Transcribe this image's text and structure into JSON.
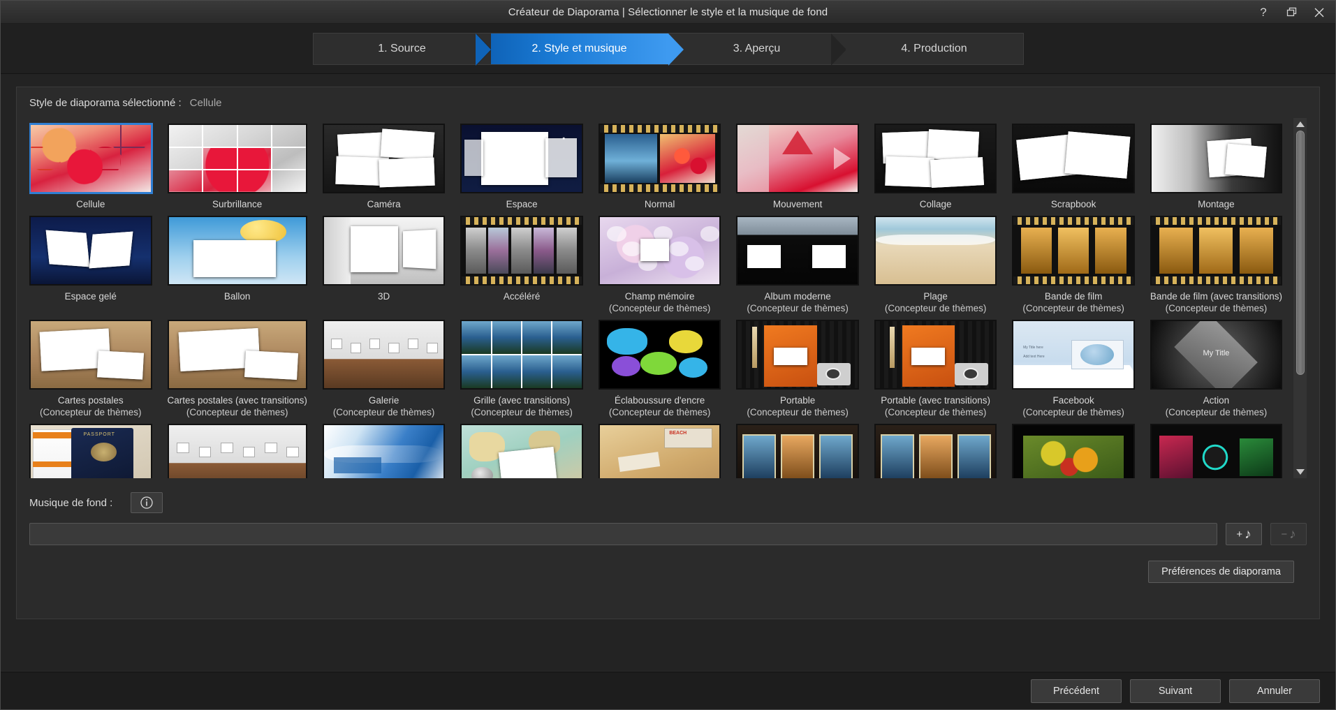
{
  "titlebar": {
    "title": "Créateur de Diaporama | Sélectionner le style et la musique de fond",
    "help_icon": "question-mark-icon",
    "restore_icon": "restore-window-icon",
    "close_icon": "close-icon"
  },
  "wizard": {
    "steps": [
      {
        "label": "1. Source",
        "active": false
      },
      {
        "label": "2. Style et musique",
        "active": true
      },
      {
        "label": "3. Aperçu",
        "active": false
      },
      {
        "label": "4. Production",
        "active": false
      }
    ],
    "active_color": "#1a7ad4"
  },
  "selected_style": {
    "label": "Style de diaporama sélectionné :",
    "value": "Cellule"
  },
  "styles": [
    {
      "name": "Cellule",
      "sub": "",
      "selected": true,
      "art": "cellule"
    },
    {
      "name": "Surbrillance",
      "sub": "",
      "selected": false,
      "art": "surbrillance"
    },
    {
      "name": "Caméra",
      "sub": "",
      "selected": false,
      "art": "camera"
    },
    {
      "name": "Espace",
      "sub": "",
      "selected": false,
      "art": "espace"
    },
    {
      "name": "Normal",
      "sub": "",
      "selected": false,
      "art": "normal"
    },
    {
      "name": "Mouvement",
      "sub": "",
      "selected": false,
      "art": "mouvement"
    },
    {
      "name": "Collage",
      "sub": "",
      "selected": false,
      "art": "collage"
    },
    {
      "name": "Scrapbook",
      "sub": "",
      "selected": false,
      "art": "scrapbook"
    },
    {
      "name": "Montage",
      "sub": "",
      "selected": false,
      "art": "montage"
    },
    {
      "name": "Espace gelé",
      "sub": "",
      "selected": false,
      "art": "espace-gele"
    },
    {
      "name": "Ballon",
      "sub": "",
      "selected": false,
      "art": "ballon"
    },
    {
      "name": "3D",
      "sub": "",
      "selected": false,
      "art": "trois-d"
    },
    {
      "name": "Accéléré",
      "sub": "",
      "selected": false,
      "art": "accelere"
    },
    {
      "name": "Champ mémoire",
      "sub": "(Concepteur de thèmes)",
      "selected": false,
      "art": "champ-memoire"
    },
    {
      "name": "Album moderne",
      "sub": "(Concepteur de thèmes)",
      "selected": false,
      "art": "album-moderne"
    },
    {
      "name": "Plage",
      "sub": "(Concepteur de thèmes)",
      "selected": false,
      "art": "plage"
    },
    {
      "name": "Bande de film",
      "sub": "(Concepteur de thèmes)",
      "selected": false,
      "art": "bande-de-film"
    },
    {
      "name": "Bande de film (avec transitions)",
      "sub": "(Concepteur de thèmes)",
      "selected": false,
      "art": "bande-de-film-transitions"
    },
    {
      "name": "Cartes postales",
      "sub": "(Concepteur de thèmes)",
      "selected": false,
      "art": "cartes-postales"
    },
    {
      "name": "Cartes postales (avec transitions)",
      "sub": "(Concepteur de thèmes)",
      "selected": false,
      "art": "cartes-postales-transitions"
    },
    {
      "name": "Galerie",
      "sub": "(Concepteur de thèmes)",
      "selected": false,
      "art": "galerie"
    },
    {
      "name": "Grille (avec transitions)",
      "sub": "(Concepteur de thèmes)",
      "selected": false,
      "art": "grille-transitions"
    },
    {
      "name": "Éclaboussure d'encre",
      "sub": "(Concepteur de thèmes)",
      "selected": false,
      "art": "eclaboussure"
    },
    {
      "name": "Portable",
      "sub": "(Concepteur de thèmes)",
      "selected": false,
      "art": "portable"
    },
    {
      "name": "Portable (avec transitions)",
      "sub": "(Concepteur de thèmes)",
      "selected": false,
      "art": "portable-transitions"
    },
    {
      "name": "Facebook",
      "sub": "(Concepteur de thèmes)",
      "selected": false,
      "art": "facebook"
    },
    {
      "name": "Action",
      "sub": "(Concepteur de thèmes)",
      "selected": false,
      "art": "action"
    },
    {
      "name": "",
      "sub": "",
      "selected": false,
      "art": "passeport"
    },
    {
      "name": "",
      "sub": "",
      "selected": false,
      "art": "galerie2"
    },
    {
      "name": "",
      "sub": "",
      "selected": false,
      "art": "vagues-bleues"
    },
    {
      "name": "",
      "sub": "",
      "selected": false,
      "art": "carte-monde"
    },
    {
      "name": "",
      "sub": "",
      "selected": false,
      "art": "plage-carte"
    },
    {
      "name": "",
      "sub": "",
      "selected": false,
      "art": "diapos-sombres"
    },
    {
      "name": "",
      "sub": "",
      "selected": false,
      "art": "diapos-sombres2"
    },
    {
      "name": "",
      "sub": "",
      "selected": false,
      "art": "fleurs-noir"
    },
    {
      "name": "",
      "sub": "",
      "selected": false,
      "art": "neon-noir"
    }
  ],
  "scrollbar": {
    "up_icon": "scroll-up-arrow-icon",
    "down_icon": "scroll-down-arrow-icon",
    "thumb_position_percent": 0,
    "thumb_size_percent": 73
  },
  "music": {
    "label": "Musique de fond :",
    "info_icon": "info-icon",
    "input_value": "",
    "input_placeholder": "",
    "add_button_label": "+",
    "add_button_icon": "music-note-icon",
    "remove_button_label": "−",
    "remove_button_icon": "music-note-icon",
    "remove_button_disabled": true
  },
  "preferences_button": "Préférences de diaporama",
  "footer": {
    "back": "Précédent",
    "next": "Suivant",
    "cancel": "Annuler"
  }
}
